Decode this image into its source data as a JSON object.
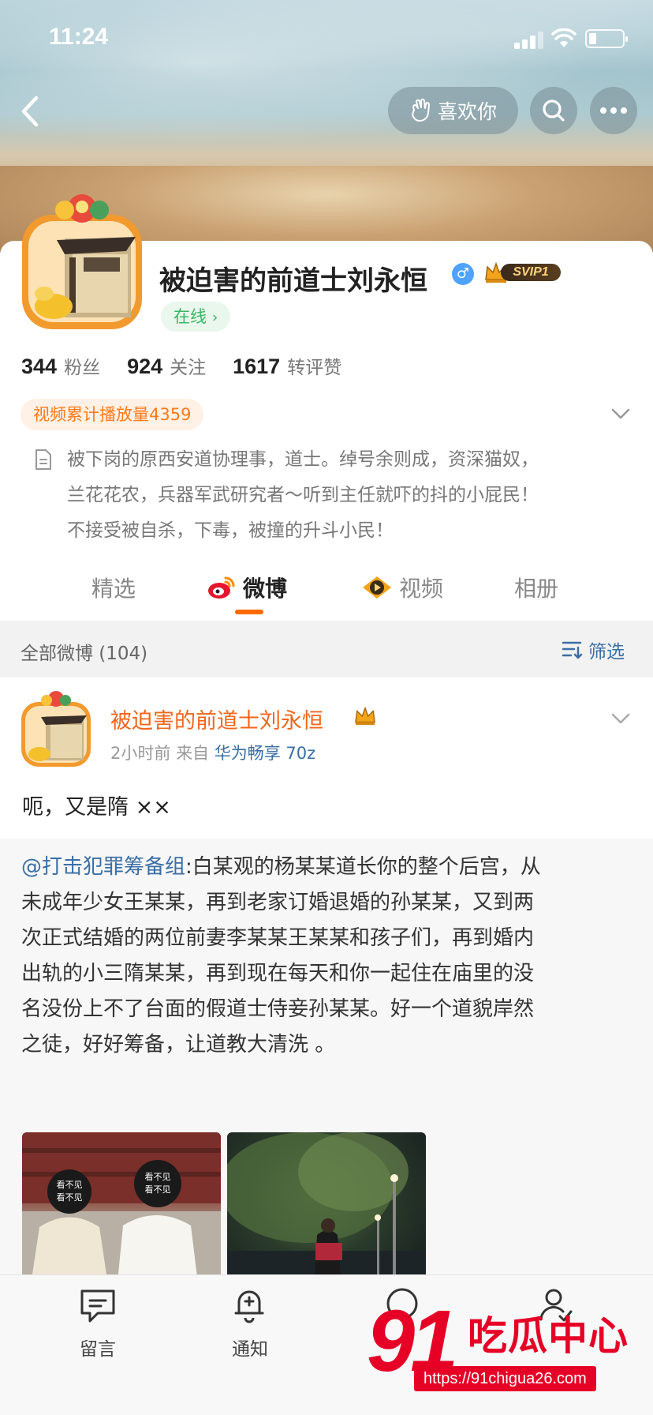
{
  "status_bar": {
    "time": "11:24"
  },
  "header": {
    "like_button_label": "喜欢你"
  },
  "profile": {
    "name": "被迫害的前道士刘永恒",
    "vip_label": "SVIP1",
    "online_status": "在线",
    "stats": [
      {
        "value": "344",
        "label": "粉丝"
      },
      {
        "value": "924",
        "label": "关注"
      },
      {
        "value": "1617",
        "label": "转评赞"
      }
    ],
    "video_views_label": "视频累计播放量4359",
    "bio_lines": [
      "被下岗的原西安道协理事，道士。绰号余则成，资深猫奴，",
      "兰花花农，兵器军武研究者～听到主任就吓的抖的小屁民！",
      "不接受被自杀，下毒，被撞的升斗小民！"
    ]
  },
  "tabs": [
    {
      "label": "精选"
    },
    {
      "label": "微博"
    },
    {
      "label": "视频"
    },
    {
      "label": "相册"
    }
  ],
  "filter_bar": {
    "count_label": "全部微博 (104)",
    "filter_label": "筛选"
  },
  "post": {
    "author": "被迫害的前道士刘永恒",
    "time": "2小时前",
    "from_prefix": "来自",
    "source": "华为畅享 70z",
    "text": "呃，又是隋 ××",
    "repost": {
      "mention": "@打击犯罪筹备组",
      "lines": [
        ":白某观的杨某某道长你的整个后宫，从",
        "未成年少女王某某，再到老家订婚退婚的孙某某，又到两",
        "次正式结婚的两位前妻李某某王某某和孩子们，再到婚内",
        "出轨的小三隋某某，再到现在每天和你一起住在庙里的没",
        "名没份上不了台面的假道士侍妾孙某某。好一个道貌岸然",
        "之徒，好好筹备，让道教大清洗 。"
      ],
      "image_overlay_text": "看不见"
    }
  },
  "bottom_bar": [
    {
      "label": "留言",
      "icon": "message-icon"
    },
    {
      "label": "通知",
      "icon": "bell-add-icon"
    },
    {
      "label": "",
      "icon": "chat-icon"
    },
    {
      "label": "",
      "icon": "user-check-icon"
    }
  ],
  "watermark": {
    "number": "91",
    "text": "吃瓜中心",
    "url": "https://91chigua26.com"
  },
  "colors": {
    "accent": "#ff6a00",
    "link": "#3a6ea5",
    "online": "#3cb566",
    "watermark": "#e60026"
  }
}
